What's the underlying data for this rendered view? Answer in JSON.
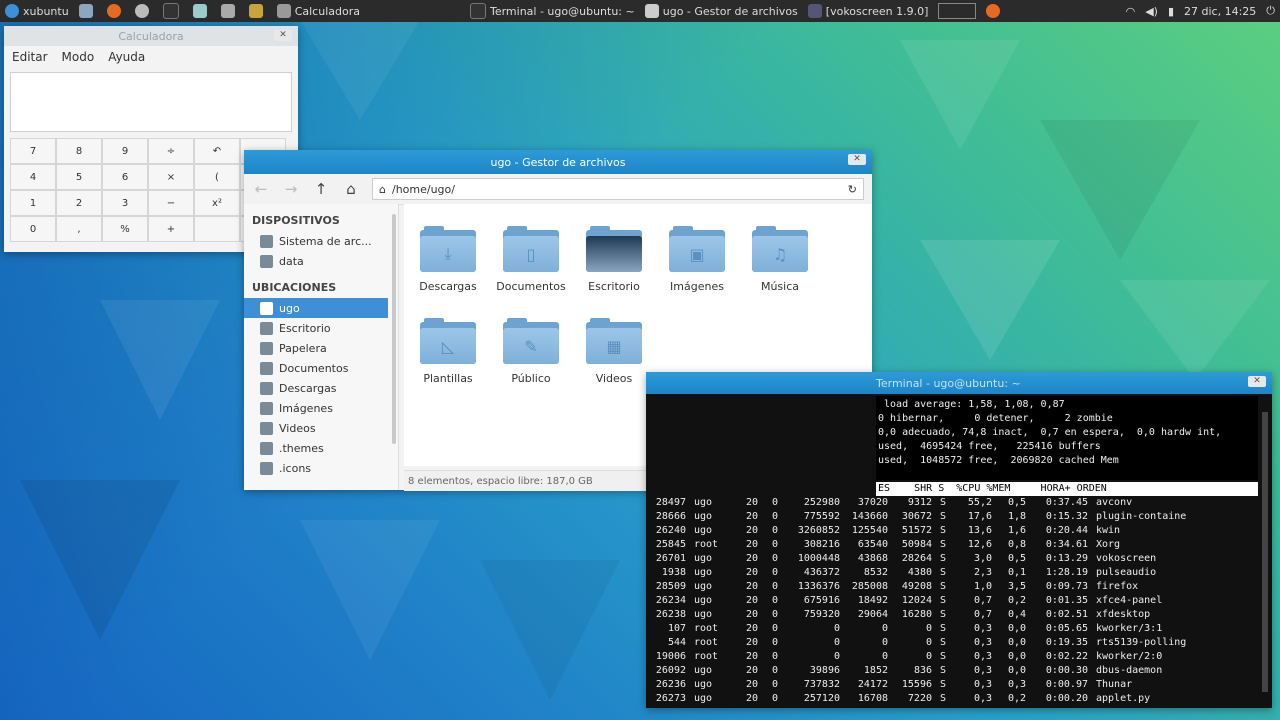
{
  "panel": {
    "start_label": "xubuntu",
    "active_app": "Calculadora",
    "tasks": [
      "Terminal - ugo@ubuntu: ~",
      "ugo - Gestor de archivos",
      "[vokoscreen 1.9.0]"
    ],
    "datetime": "27 dic, 14:25"
  },
  "calculator": {
    "title": "Calculadora",
    "menu": [
      "Editar",
      "Modo",
      "Ayuda"
    ],
    "keys": [
      "7",
      "8",
      "9",
      "÷",
      "↶",
      "",
      "4",
      "5",
      "6",
      "×",
      "(",
      "",
      "1",
      "2",
      "3",
      "−",
      "x²",
      "",
      "0",
      ",",
      "%",
      "+",
      "",
      ""
    ]
  },
  "file_manager": {
    "title": "ugo - Gestor de archivos",
    "path": "/home/ugo/",
    "sections": [
      {
        "title": "DISPOSITIVOS",
        "items": [
          {
            "label": "Sistema de arc...",
            "icon": "drive-icon"
          },
          {
            "label": "data",
            "icon": "drive-icon"
          }
        ]
      },
      {
        "title": "UBICACIONES",
        "items": [
          {
            "label": "ugo",
            "icon": "home-icon",
            "selected": true
          },
          {
            "label": "Escritorio",
            "icon": "desktop-icon"
          },
          {
            "label": "Papelera",
            "icon": "trash-icon"
          },
          {
            "label": "Documentos",
            "icon": "document-icon"
          },
          {
            "label": "Descargas",
            "icon": "download-icon"
          },
          {
            "label": "Imágenes",
            "icon": "image-icon"
          },
          {
            "label": "Videos",
            "icon": "video-icon"
          },
          {
            "label": ".themes",
            "icon": "folder-icon"
          },
          {
            "label": ".icons",
            "icon": "folder-icon"
          }
        ]
      }
    ],
    "files": [
      {
        "label": "Descargas",
        "glyph": "⤓"
      },
      {
        "label": "Documentos",
        "glyph": "▯"
      },
      {
        "label": "Escritorio",
        "glyph": ""
      },
      {
        "label": "Imágenes",
        "glyph": "▣"
      },
      {
        "label": "Música",
        "glyph": "♫"
      },
      {
        "label": "Plantillas",
        "glyph": "◺"
      },
      {
        "label": "Público",
        "glyph": "✎"
      },
      {
        "label": "Videos",
        "glyph": "▦"
      }
    ],
    "status": "8 elementos, espacio libre: 187,0 GB"
  },
  "terminal": {
    "title": "Terminal - ugo@ubuntu: ~",
    "summary": [
      " load average: 1,58, 1,08, 0,87",
      "0 hibernar,     0 detener,     2 zombie",
      "0,0 adecuado, 74,8 inact,  0,7 en espera,  0,0 hardw int,",
      "used,  4695424 free,   225416 buffers",
      "used,  1048572 free,  2069820 cached Mem"
    ],
    "header": "ES    SHR S  %CPU %MEM     HORA+ ORDEN",
    "processes": [
      [
        "28497",
        "ugo",
        "20",
        "0",
        "252980",
        "37020",
        "9312",
        "S",
        "55,2",
        "0,5",
        "0:37.45",
        "avconv"
      ],
      [
        "28666",
        "ugo",
        "20",
        "0",
        "775592",
        "143660",
        "30672",
        "S",
        "17,6",
        "1,8",
        "0:15.32",
        "plugin-containe"
      ],
      [
        "26240",
        "ugo",
        "20",
        "0",
        "3260852",
        "125540",
        "51572",
        "S",
        "13,6",
        "1,6",
        "0:20.44",
        "kwin"
      ],
      [
        "25845",
        "root",
        "20",
        "0",
        "308216",
        "63540",
        "50984",
        "S",
        "12,6",
        "0,8",
        "0:34.61",
        "Xorg"
      ],
      [
        "26701",
        "ugo",
        "20",
        "0",
        "1000448",
        "43868",
        "28264",
        "S",
        "3,0",
        "0,5",
        "0:13.29",
        "vokoscreen"
      ],
      [
        "1938",
        "ugo",
        "20",
        "0",
        "436372",
        "8532",
        "4380",
        "S",
        "2,3",
        "0,1",
        "1:28.19",
        "pulseaudio"
      ],
      [
        "28509",
        "ugo",
        "20",
        "0",
        "1336376",
        "285008",
        "49208",
        "S",
        "1,0",
        "3,5",
        "0:09.73",
        "firefox"
      ],
      [
        "26234",
        "ugo",
        "20",
        "0",
        "675916",
        "18492",
        "12024",
        "S",
        "0,7",
        "0,2",
        "0:01.35",
        "xfce4-panel"
      ],
      [
        "26238",
        "ugo",
        "20",
        "0",
        "759320",
        "29064",
        "16280",
        "S",
        "0,7",
        "0,4",
        "0:02.51",
        "xfdesktop"
      ],
      [
        "107",
        "root",
        "20",
        "0",
        "0",
        "0",
        "0",
        "S",
        "0,3",
        "0,0",
        "0:05.65",
        "kworker/3:1"
      ],
      [
        "544",
        "root",
        "20",
        "0",
        "0",
        "0",
        "0",
        "S",
        "0,3",
        "0,0",
        "0:19.35",
        "rts5139-polling"
      ],
      [
        "19006",
        "root",
        "20",
        "0",
        "0",
        "0",
        "0",
        "S",
        "0,3",
        "0,0",
        "0:02.22",
        "kworker/2:0"
      ],
      [
        "26092",
        "ugo",
        "20",
        "0",
        "39896",
        "1852",
        "836",
        "S",
        "0,3",
        "0,0",
        "0:00.30",
        "dbus-daemon"
      ],
      [
        "26236",
        "ugo",
        "20",
        "0",
        "737832",
        "24172",
        "15596",
        "S",
        "0,3",
        "0,3",
        "0:00.97",
        "Thunar"
      ],
      [
        "26273",
        "ugo",
        "20",
        "0",
        "257120",
        "16708",
        "7220",
        "S",
        "0,3",
        "0,2",
        "0:00.20",
        "applet.py"
      ]
    ]
  }
}
